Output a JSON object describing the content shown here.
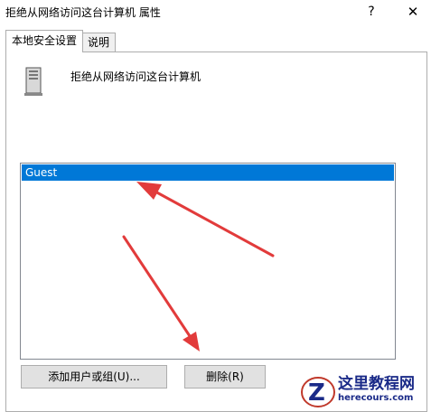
{
  "window": {
    "title": "拒绝从网络访问这台计算机 属性",
    "help_symbol": "?",
    "close_symbol": "✕"
  },
  "tabs": [
    {
      "label": "本地安全设置",
      "active": true
    },
    {
      "label": "说明",
      "active": false
    }
  ],
  "policy": {
    "icon": "server-tower-icon",
    "name": "拒绝从网络访问这台计算机"
  },
  "accounts": {
    "items": [
      "Guest"
    ],
    "selected_index": 0
  },
  "buttons": {
    "add": "添加用户或组(U)...",
    "remove": "删除(R)"
  },
  "watermark": {
    "text": "这里教程网",
    "url": "herecours.com"
  },
  "colors": {
    "selection": "#0078d7",
    "annotation_arrow": "#e23b3b",
    "watermark_blue": "#1a2a88"
  }
}
